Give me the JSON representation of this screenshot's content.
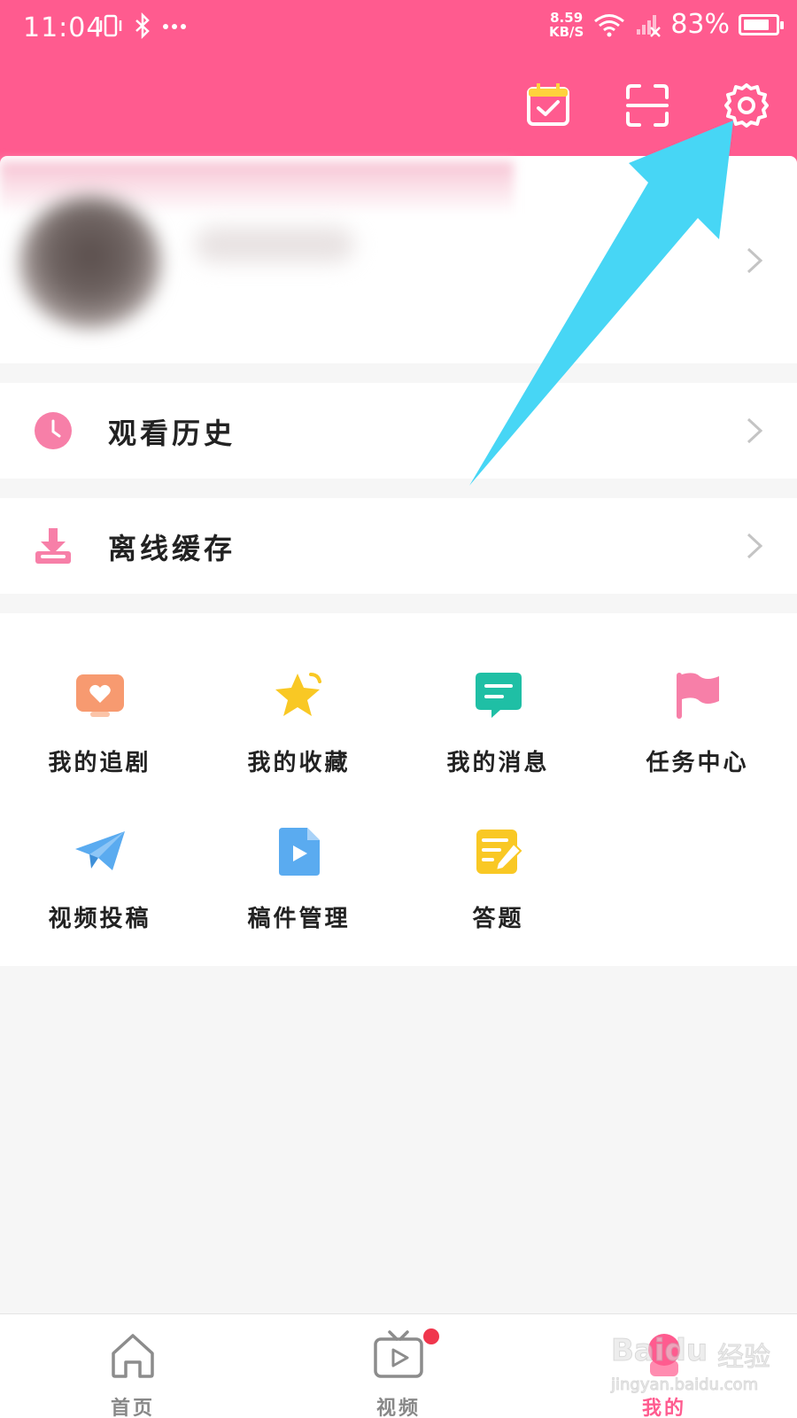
{
  "status_bar": {
    "time": "11:04",
    "net_speed_value": "8.59",
    "net_speed_unit": "KB/S",
    "battery_percent": "83%",
    "battery_level": 0.83
  },
  "profile": {
    "chevron_icon": "chevron-right-icon"
  },
  "menu": [
    {
      "label": "观看历史",
      "icon": "clock-icon",
      "color": "#f77fa8"
    },
    {
      "label": "离线缓存",
      "icon": "download-icon",
      "color": "#f77fa8"
    }
  ],
  "grid": [
    {
      "label": "我的追剧",
      "icon": "heart-tv-icon",
      "color": "#f79a70"
    },
    {
      "label": "我的收藏",
      "icon": "star-icon",
      "color": "#f9c824"
    },
    {
      "label": "我的消息",
      "icon": "message-icon",
      "color": "#1fbfa5"
    },
    {
      "label": "任务中心",
      "icon": "flag-icon",
      "color": "#f77fa8"
    },
    {
      "label": "视频投稿",
      "icon": "paper-plane-icon",
      "color": "#5aabf0"
    },
    {
      "label": "稿件管理",
      "icon": "video-file-icon",
      "color": "#5aabf0"
    },
    {
      "label": "答题",
      "icon": "edit-note-icon",
      "color": "#f9c824"
    }
  ],
  "tabbar": [
    {
      "label": "首页",
      "icon": "home-icon",
      "active": false
    },
    {
      "label": "视频",
      "icon": "tv-play-icon",
      "active": false,
      "badge": true
    },
    {
      "label": "我的",
      "icon": "profile-icon",
      "active": true
    }
  ],
  "watermark": {
    "brand": "Baidu",
    "suffix": "经验",
    "url": "jingyan.baidu.com"
  },
  "colors": {
    "header": "#ff5b8f",
    "accent": "#ff5b8f",
    "arrow": "#47d6f5"
  }
}
